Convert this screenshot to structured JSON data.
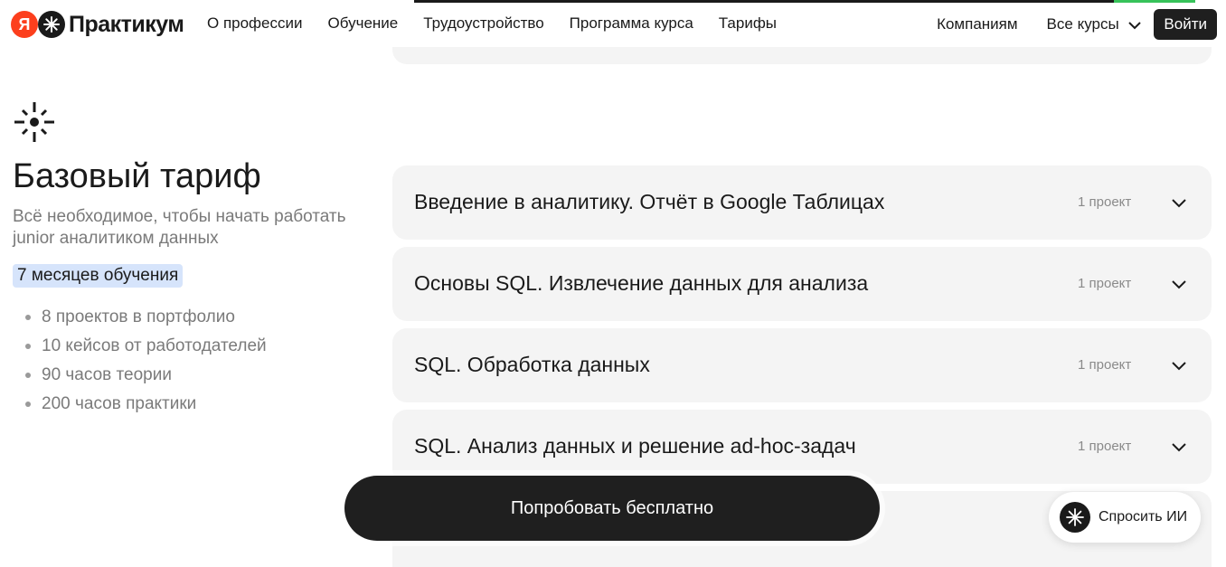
{
  "header": {
    "logo_ya": "Я",
    "logo_text": "Практикум",
    "nav": [
      "О профессии",
      "Обучение",
      "Трудоустройство",
      "Программа курса",
      "Тарифы"
    ],
    "companies": "Компаниям",
    "all_courses": "Все курсы",
    "login": "Войти"
  },
  "tariff": {
    "icon": "sparkle-icon",
    "title": "Базовый тариф",
    "description": "Всё необходимое, чтобы начать работать junior аналитиком данных",
    "duration": "7 месяцев обучения",
    "features": [
      "8 проектов в портфолио",
      "10 кейсов от работодателей",
      "90 часов теории",
      "200 часов практики"
    ]
  },
  "modules": [
    {
      "title": "Введение в аналитику. Отчёт в Google Таблицах",
      "count": "1 проект"
    },
    {
      "title": "Основы SQL. Извлечение данных для анализа",
      "count": "1 проект"
    },
    {
      "title": "SQL. Обработка данных",
      "count": "1 проект"
    },
    {
      "title": "SQL. Анализ данных и решение ad-hoc-задач",
      "count": "1 проект"
    }
  ],
  "cta": {
    "label": "Попробовать бесплатно"
  },
  "ask_ai": {
    "label": "Спросить ИИ",
    "icon": "sparkle-icon"
  },
  "colors": {
    "accent": "#fc3f1d",
    "dark": "#1f1f1f",
    "badge": "#d6e4fb",
    "card": "#f4f4f4",
    "progress": "#37c25a"
  }
}
